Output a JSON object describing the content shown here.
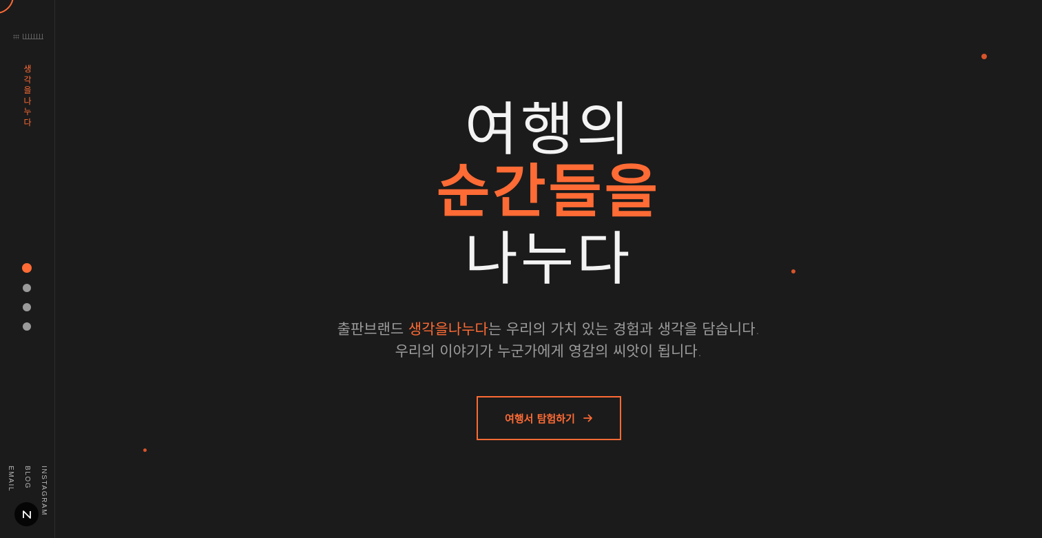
{
  "brand": {
    "vertical_name": "생각을나누다"
  },
  "sidebar": {
    "pager_dots": [
      {
        "active": true
      },
      {
        "active": false
      },
      {
        "active": false
      },
      {
        "active": false
      }
    ],
    "social": {
      "email": "EMAIL",
      "blog": "BLOG",
      "instagram": "INSTAGRAM"
    },
    "badge_letter": "N"
  },
  "hero": {
    "title_line1": "여행의",
    "title_line2": "순간들을",
    "title_line3": "나누다",
    "subtitle_prefix": "출판브랜드 ",
    "subtitle_accent": "생각을나누다",
    "subtitle_suffix": "는 우리의 가치 있는 경험과 생각을 담습니다.",
    "subtitle_line2": "우리의 이야기가 누군가에게 영감의 씨앗이 됩니다.",
    "cta_label": "여행서 탐험하기"
  },
  "colors": {
    "accent": "#ff6b35",
    "background": "#1b1b1b",
    "text": "#f3f3f3",
    "muted": "#9c9c9c"
  },
  "icons": {
    "cta_arrow": "arrow-right-icon",
    "badge": "n-logo-icon"
  }
}
